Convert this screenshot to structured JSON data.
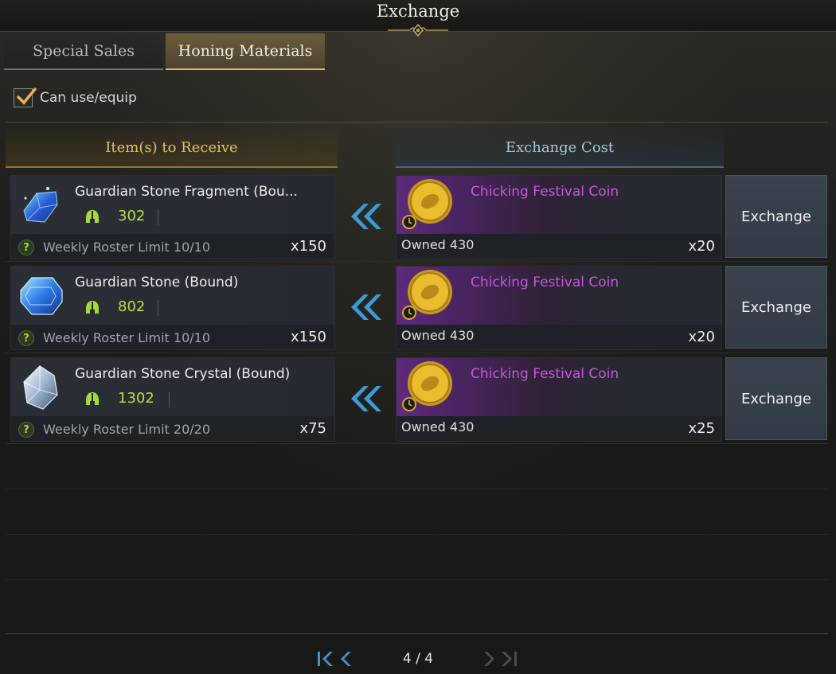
{
  "window": {
    "title": "Exchange"
  },
  "tabs": [
    {
      "label": "Special Sales",
      "active": false
    },
    {
      "label": "Honing Materials",
      "active": true
    }
  ],
  "filter": {
    "label": "Can use/equip",
    "checked": true
  },
  "headers": {
    "receive": "Item(s) to Receive",
    "cost": "Exchange Cost"
  },
  "rows": [
    {
      "item_name": "Guardian Stone Fragment (Bou...",
      "item_level": "302",
      "limit": "Weekly Roster Limit 10/10",
      "receive_qty": "x150",
      "cost_name": "Chicking Festival Coin",
      "owned": "Owned 430",
      "cost_qty": "x20",
      "button": "Exchange",
      "icon": "blue-fragment-icon"
    },
    {
      "item_name": "Guardian Stone (Bound)",
      "item_level": "802",
      "limit": "Weekly Roster Limit 10/10",
      "receive_qty": "x150",
      "cost_name": "Chicking Festival Coin",
      "owned": "Owned 430",
      "cost_qty": "x20",
      "button": "Exchange",
      "icon": "blue-stone-icon"
    },
    {
      "item_name": "Guardian Stone Crystal (Bound)",
      "item_level": "1302",
      "limit": "Weekly Roster Limit 20/20",
      "receive_qty": "x75",
      "cost_name": "Chicking Festival Coin",
      "owned": "Owned 430",
      "cost_qty": "x25",
      "button": "Exchange",
      "icon": "white-crystal-icon"
    }
  ],
  "pagination": {
    "text": "4 / 4"
  },
  "colors": {
    "gold_accent": "#e8c15d",
    "cost_accent": "#a9c6d6",
    "coin_name": "#c45bdb",
    "item_level": "#b9df3f"
  }
}
